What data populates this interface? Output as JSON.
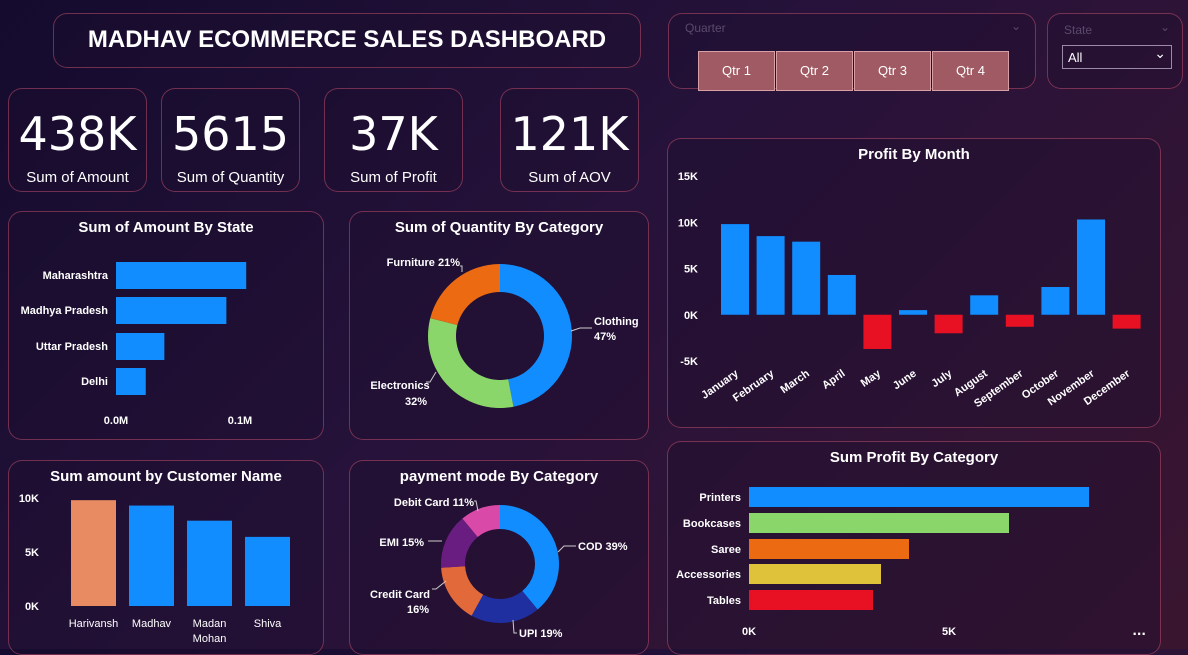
{
  "dashboard_title": "MADHAV ECOMMERCE SALES DASHBOARD",
  "slicers": {
    "quarter": {
      "label": "Quarter",
      "buttons": [
        "Qtr 1",
        "Qtr 2",
        "Qtr 3",
        "Qtr 4"
      ]
    },
    "state": {
      "label": "State",
      "selected": "All"
    }
  },
  "kpis": [
    {
      "value": "438K",
      "label": "Sum of Amount"
    },
    {
      "value": "5615",
      "label": "Sum of Quantity"
    },
    {
      "value": "37K",
      "label": "Sum of Profit"
    },
    {
      "value": "121K",
      "label": "Sum of AOV"
    }
  ],
  "colors": {
    "blue": "#118dff",
    "red": "#e81123",
    "green": "#8ad66a",
    "orange": "#ec6a12",
    "yellow": "#e0c13a",
    "salmon": "#e88a62",
    "purple": "#6a1d80",
    "pink": "#d94aa8",
    "navy": "#1f2fa0"
  },
  "more_options": "...",
  "chart_data": [
    {
      "id": "amount_by_state",
      "type": "bar",
      "orientation": "horizontal",
      "title": "Sum of Amount By State",
      "categories": [
        "Maharashtra",
        "Madhya Pradesh",
        "Uttar Pradesh",
        "Delhi"
      ],
      "values": [
        0.105,
        0.089,
        0.039,
        0.024
      ],
      "xlim": [
        0,
        0.1
      ],
      "xticks": [
        "0.0M",
        "0.1M"
      ],
      "unit": "M"
    },
    {
      "id": "quantity_by_category",
      "type": "pie",
      "donut": true,
      "title": "Sum of Quantity By Category",
      "slices": [
        {
          "label": "Clothing",
          "pct": "47%",
          "value": 47,
          "color": "#118dff"
        },
        {
          "label": "Electronics",
          "pct": "32%",
          "value": 32,
          "color": "#8ad66a"
        },
        {
          "label": "Furniture",
          "pct": "21%",
          "value": 21,
          "color": "#ec6a12"
        }
      ]
    },
    {
      "id": "profit_by_month",
      "type": "bar",
      "title": "Profit By Month",
      "categories": [
        "January",
        "February",
        "March",
        "April",
        "May",
        "June",
        "July",
        "August",
        "September",
        "October",
        "November",
        "December"
      ],
      "values": [
        9800,
        8500,
        7900,
        4300,
        -3700,
        500,
        -2000,
        2100,
        -1300,
        3000,
        10300,
        -1500
      ],
      "ylim": [
        -5000,
        15000
      ],
      "yticks": [
        "-5K",
        "0K",
        "5K",
        "10K",
        "15K"
      ],
      "ytick_values": [
        -5000,
        0,
        5000,
        10000,
        15000
      ]
    },
    {
      "id": "amount_by_customer",
      "type": "bar",
      "title": "Sum amount by Customer Name",
      "categories": [
        "Harivansh",
        "Madhav",
        "Madan Mohan",
        "Shiva"
      ],
      "values": [
        9800,
        9300,
        7900,
        6400
      ],
      "ylim": [
        0,
        10000
      ],
      "yticks": [
        "0K",
        "5K",
        "10K"
      ],
      "ytick_values": [
        0,
        5000,
        10000
      ]
    },
    {
      "id": "payment_mode",
      "type": "pie",
      "donut": true,
      "title": "payment mode By Category",
      "slices": [
        {
          "label": "COD",
          "pct": "39%",
          "value": 39,
          "color": "#118dff"
        },
        {
          "label": "UPI",
          "pct": "19%",
          "value": 19,
          "color": "#1f2fa0"
        },
        {
          "label": "Credit Card",
          "pct": "16%",
          "value": 16,
          "color": "#e2693a"
        },
        {
          "label": "EMI",
          "pct": "15%",
          "value": 15,
          "color": "#6a1d80"
        },
        {
          "label": "Debit Card",
          "pct": "11%",
          "value": 11,
          "color": "#d94aa8"
        }
      ]
    },
    {
      "id": "profit_by_category",
      "type": "bar",
      "orientation": "horizontal",
      "title": "Sum Profit By Category",
      "categories": [
        "Printers",
        "Bookcases",
        "Saree",
        "Accessories",
        "Tables"
      ],
      "values": [
        8500,
        6500,
        4000,
        3300,
        3100
      ],
      "colors": [
        "#118dff",
        "#8ad66a",
        "#ec6a12",
        "#e0c13a",
        "#e81123"
      ],
      "xlim": [
        0,
        5000
      ],
      "xticks": [
        "0K",
        "5K"
      ],
      "xtick_values": [
        0,
        5000
      ]
    }
  ]
}
